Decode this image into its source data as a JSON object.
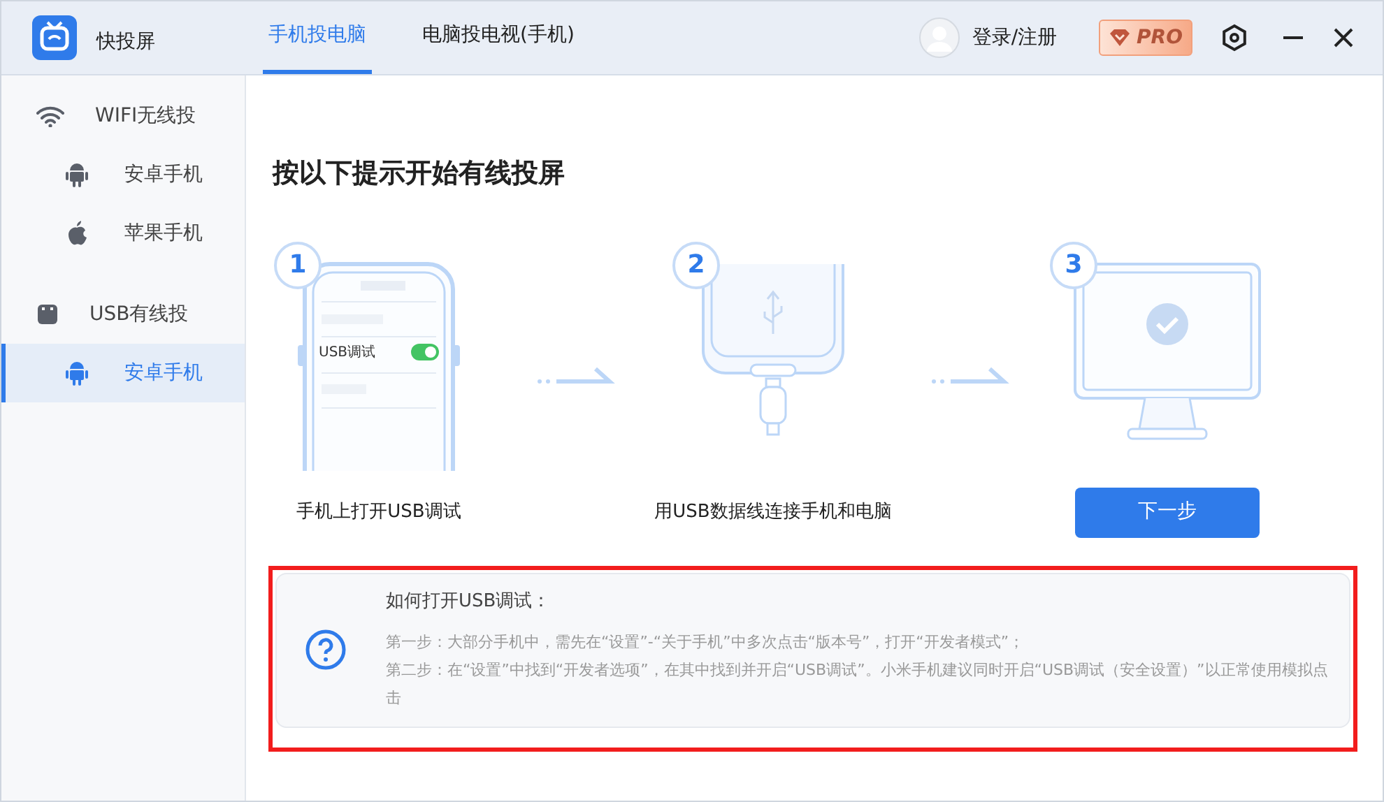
{
  "app": {
    "name": "快投屏"
  },
  "tabs": [
    {
      "label": "手机投电脑",
      "selected": true
    },
    {
      "label": "电脑投电视(手机)",
      "selected": false
    }
  ],
  "account": {
    "login": "登录/注册",
    "pro": "PRO"
  },
  "sidebar": {
    "groups": [
      {
        "label": "WIFI无线投",
        "kind": "wifi",
        "children": [
          {
            "label": "安卓手机",
            "kind": "android",
            "selected": false
          },
          {
            "label": "苹果手机",
            "kind": "apple",
            "selected": false
          }
        ]
      },
      {
        "label": "USB有线投",
        "kind": "usb",
        "children": [
          {
            "label": "安卓手机",
            "kind": "android",
            "selected": true
          }
        ]
      }
    ]
  },
  "main": {
    "title": "按以下提示开始有线投屏",
    "steps": [
      {
        "number": "1",
        "kind": "phone",
        "caption": "手机上打开USB调试",
        "toggle_label": "USB调试",
        "toggle_on": true
      },
      {
        "number": "2",
        "kind": "cable",
        "caption": "用USB数据线连接手机和电脑"
      },
      {
        "number": "3",
        "kind": "monitor",
        "button": "下一步"
      }
    ],
    "help": {
      "title": "如何打开USB调试：",
      "lines": [
        "第一步：大部分手机中，需先在“设置”-“关于手机”中多次点击“版本号”，打开“开发者模式”；",
        "第二步：在“设置”中找到“开发者选项”，在其中找到并开启“USB调试”。小米手机建议同时开启“USB调试（安全设置）”以正常使用模拟点击"
      ]
    }
  }
}
